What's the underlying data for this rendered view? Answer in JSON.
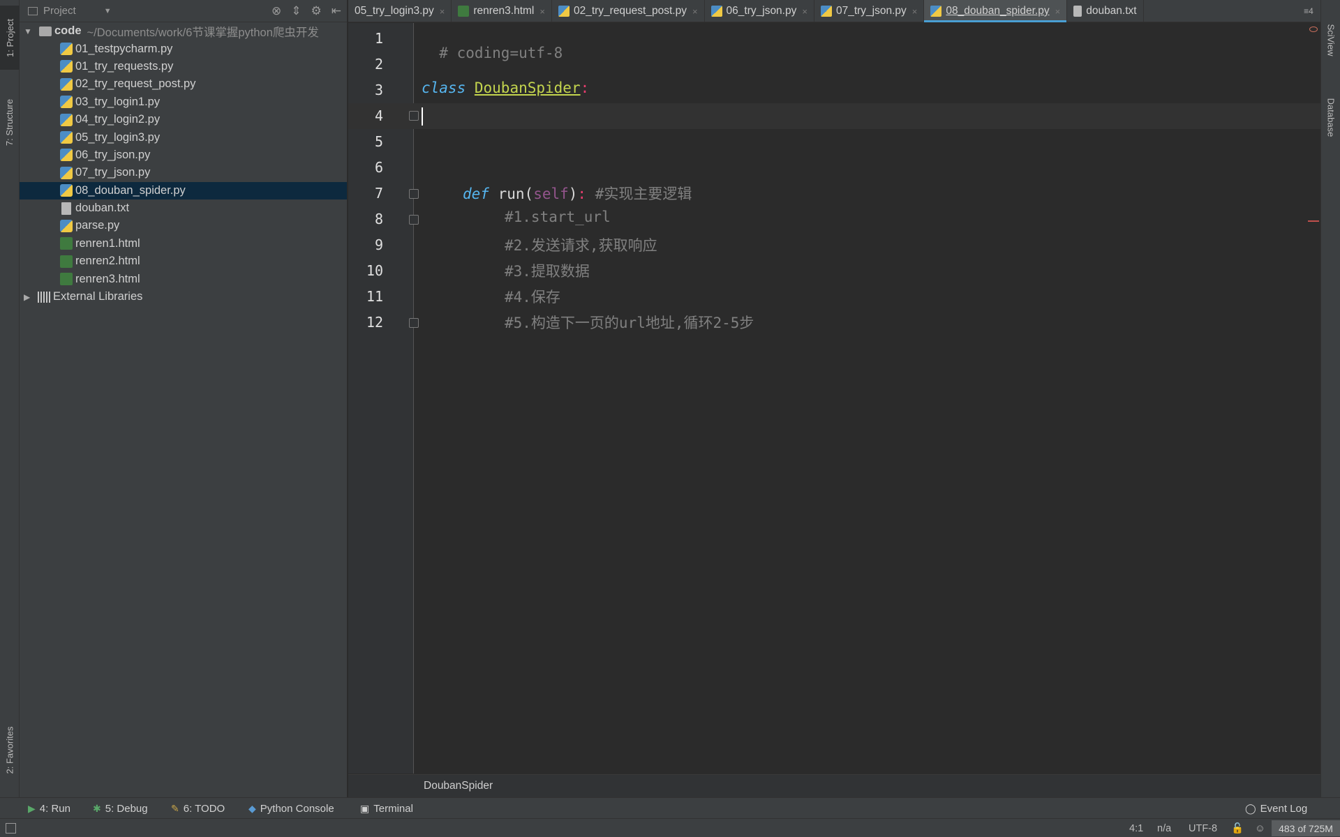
{
  "left_strip": {
    "project_tab": "1: Project",
    "structure_tab": "7: Structure",
    "favorites_tab": "2: Favorites"
  },
  "project_panel": {
    "header_title": "Project",
    "root": {
      "name": "code",
      "path": "~/Documents/work/6节课掌握python爬虫开发"
    },
    "files": [
      {
        "name": "01_testpycharm.py",
        "type": "python"
      },
      {
        "name": "01_try_requests.py",
        "type": "python"
      },
      {
        "name": "02_try_request_post.py",
        "type": "python"
      },
      {
        "name": "03_try_login1.py",
        "type": "python"
      },
      {
        "name": "04_try_login2.py",
        "type": "python"
      },
      {
        "name": "05_try_login3.py",
        "type": "python"
      },
      {
        "name": "06_try_json.py",
        "type": "python"
      },
      {
        "name": "07_try_json.py",
        "type": "python"
      },
      {
        "name": "08_douban_spider.py",
        "type": "python",
        "selected": true
      },
      {
        "name": "douban.txt",
        "type": "text"
      },
      {
        "name": "parse.py",
        "type": "python"
      },
      {
        "name": "renren1.html",
        "type": "html"
      },
      {
        "name": "renren2.html",
        "type": "html"
      },
      {
        "name": "renren3.html",
        "type": "html"
      }
    ],
    "external_libraries": "External Libraries"
  },
  "editor_tabs": [
    {
      "label": "05_try_login3.py",
      "type": "python"
    },
    {
      "label": "renren3.html",
      "type": "html"
    },
    {
      "label": "02_try_request_post.py",
      "type": "python"
    },
    {
      "label": "06_try_json.py",
      "type": "python"
    },
    {
      "label": "07_try_json.py",
      "type": "python"
    },
    {
      "label": "08_douban_spider.py",
      "type": "python",
      "active": true
    },
    {
      "label": "douban.txt",
      "type": "text"
    }
  ],
  "tabs_overflow": "≡4",
  "editor": {
    "line_numbers": [
      "1",
      "2",
      "3",
      "4",
      "5",
      "6",
      "7",
      "8",
      "9",
      "10",
      "11",
      "12"
    ],
    "line1": "# coding=utf-8",
    "line3_kw": "class",
    "line3_name": "DoubanSpider",
    "line3_colon": ":",
    "line7_kw": "def",
    "line7_fn": "run",
    "line7_paren_open": "(",
    "line7_self": "self",
    "line7_paren_close": ")",
    "line7_colon": ":",
    "line7_comment": "#实现主要逻辑",
    "line8": "#1.start_url",
    "line9": "#2.发送请求,获取响应",
    "line10": "#3.提取数据",
    "line11": "#4.保存",
    "line12": "#5.构造下一页的url地址,循环2-5步"
  },
  "breadcrumb": "DoubanSpider",
  "right_strip": {
    "sciview": "SciView",
    "database": "Database"
  },
  "tool_windows": {
    "run": "4: Run",
    "debug": "5: Debug",
    "todo": "6: TODO",
    "python_console": "Python Console",
    "terminal": "Terminal",
    "event_log": "Event Log"
  },
  "status_bar": {
    "position": "4:1",
    "line_separator": "n/a",
    "encoding": "UTF-8",
    "memory": "483 of 725M"
  },
  "colors": {
    "keyword": "#56b6f0",
    "class_name": "#c4d54e",
    "comment": "#808080",
    "self": "#94558d",
    "selection": "#0d293e",
    "active_tab_underline": "#4a9fd4"
  }
}
